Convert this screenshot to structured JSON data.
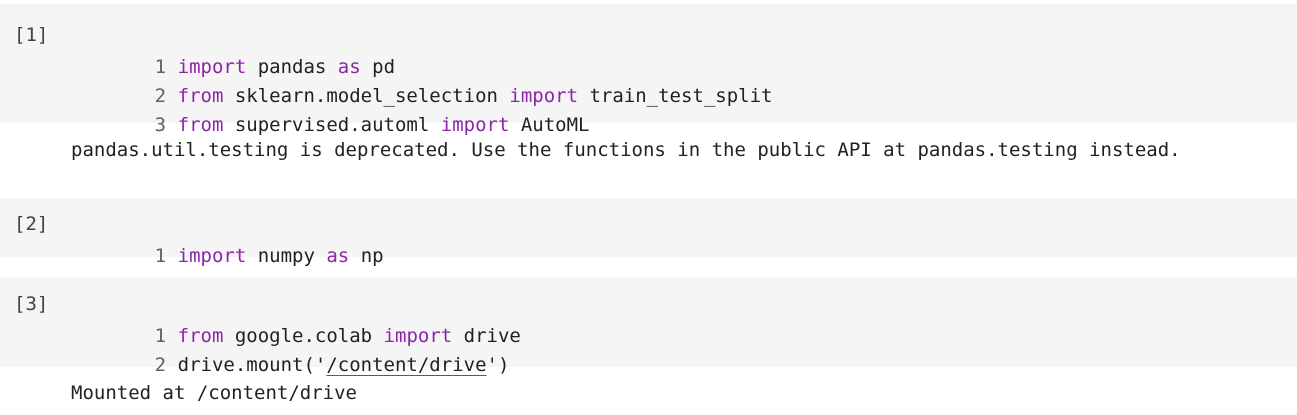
{
  "cells": [
    {
      "prompt": "[1]",
      "lines": [
        {
          "num": "1",
          "t1": "import",
          "t2": " pandas ",
          "t3": "as",
          "t4": " pd"
        },
        {
          "num": "2",
          "t1": "from",
          "t2": " sklearn.model_selection ",
          "t3": "import",
          "t4": " train_test_split"
        },
        {
          "num": "3",
          "t1": "from",
          "t2": " supervised.automl ",
          "t3": "import",
          "t4": " AutoML"
        }
      ],
      "output": "pandas.util.testing is deprecated. Use the functions in the public API at pandas.testing instead."
    },
    {
      "prompt": "[2]",
      "lines": [
        {
          "num": "1",
          "t1": "import",
          "t2": " numpy ",
          "t3": "as",
          "t4": " np"
        }
      ]
    },
    {
      "prompt": "[3]",
      "lines": [
        {
          "num": "1",
          "t1": "from",
          "t2": " google.colab ",
          "t3": "import",
          "t4": " drive"
        },
        {
          "num": "2",
          "pre": "drive.mount('",
          "link": "/content/drive",
          "post": "')"
        }
      ],
      "output": "Mounted at /content/drive"
    }
  ]
}
